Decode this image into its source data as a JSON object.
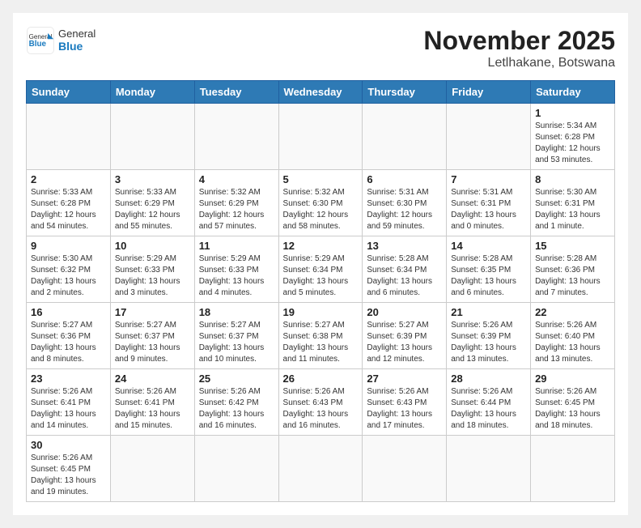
{
  "logo": {
    "general": "General",
    "blue": "Blue"
  },
  "header": {
    "title": "November 2025",
    "location": "Letlhakane, Botswana"
  },
  "weekdays": [
    "Sunday",
    "Monday",
    "Tuesday",
    "Wednesday",
    "Thursday",
    "Friday",
    "Saturday"
  ],
  "days": {
    "1": {
      "sunrise": "Sunrise: 5:34 AM",
      "sunset": "Sunset: 6:28 PM",
      "daylight": "Daylight: 12 hours and 53 minutes."
    },
    "2": {
      "sunrise": "Sunrise: 5:33 AM",
      "sunset": "Sunset: 6:28 PM",
      "daylight": "Daylight: 12 hours and 54 minutes."
    },
    "3": {
      "sunrise": "Sunrise: 5:33 AM",
      "sunset": "Sunset: 6:29 PM",
      "daylight": "Daylight: 12 hours and 55 minutes."
    },
    "4": {
      "sunrise": "Sunrise: 5:32 AM",
      "sunset": "Sunset: 6:29 PM",
      "daylight": "Daylight: 12 hours and 57 minutes."
    },
    "5": {
      "sunrise": "Sunrise: 5:32 AM",
      "sunset": "Sunset: 6:30 PM",
      "daylight": "Daylight: 12 hours and 58 minutes."
    },
    "6": {
      "sunrise": "Sunrise: 5:31 AM",
      "sunset": "Sunset: 6:30 PM",
      "daylight": "Daylight: 12 hours and 59 minutes."
    },
    "7": {
      "sunrise": "Sunrise: 5:31 AM",
      "sunset": "Sunset: 6:31 PM",
      "daylight": "Daylight: 13 hours and 0 minutes."
    },
    "8": {
      "sunrise": "Sunrise: 5:30 AM",
      "sunset": "Sunset: 6:31 PM",
      "daylight": "Daylight: 13 hours and 1 minute."
    },
    "9": {
      "sunrise": "Sunrise: 5:30 AM",
      "sunset": "Sunset: 6:32 PM",
      "daylight": "Daylight: 13 hours and 2 minutes."
    },
    "10": {
      "sunrise": "Sunrise: 5:29 AM",
      "sunset": "Sunset: 6:33 PM",
      "daylight": "Daylight: 13 hours and 3 minutes."
    },
    "11": {
      "sunrise": "Sunrise: 5:29 AM",
      "sunset": "Sunset: 6:33 PM",
      "daylight": "Daylight: 13 hours and 4 minutes."
    },
    "12": {
      "sunrise": "Sunrise: 5:29 AM",
      "sunset": "Sunset: 6:34 PM",
      "daylight": "Daylight: 13 hours and 5 minutes."
    },
    "13": {
      "sunrise": "Sunrise: 5:28 AM",
      "sunset": "Sunset: 6:34 PM",
      "daylight": "Daylight: 13 hours and 6 minutes."
    },
    "14": {
      "sunrise": "Sunrise: 5:28 AM",
      "sunset": "Sunset: 6:35 PM",
      "daylight": "Daylight: 13 hours and 6 minutes."
    },
    "15": {
      "sunrise": "Sunrise: 5:28 AM",
      "sunset": "Sunset: 6:36 PM",
      "daylight": "Daylight: 13 hours and 7 minutes."
    },
    "16": {
      "sunrise": "Sunrise: 5:27 AM",
      "sunset": "Sunset: 6:36 PM",
      "daylight": "Daylight: 13 hours and 8 minutes."
    },
    "17": {
      "sunrise": "Sunrise: 5:27 AM",
      "sunset": "Sunset: 6:37 PM",
      "daylight": "Daylight: 13 hours and 9 minutes."
    },
    "18": {
      "sunrise": "Sunrise: 5:27 AM",
      "sunset": "Sunset: 6:37 PM",
      "daylight": "Daylight: 13 hours and 10 minutes."
    },
    "19": {
      "sunrise": "Sunrise: 5:27 AM",
      "sunset": "Sunset: 6:38 PM",
      "daylight": "Daylight: 13 hours and 11 minutes."
    },
    "20": {
      "sunrise": "Sunrise: 5:27 AM",
      "sunset": "Sunset: 6:39 PM",
      "daylight": "Daylight: 13 hours and 12 minutes."
    },
    "21": {
      "sunrise": "Sunrise: 5:26 AM",
      "sunset": "Sunset: 6:39 PM",
      "daylight": "Daylight: 13 hours and 13 minutes."
    },
    "22": {
      "sunrise": "Sunrise: 5:26 AM",
      "sunset": "Sunset: 6:40 PM",
      "daylight": "Daylight: 13 hours and 13 minutes."
    },
    "23": {
      "sunrise": "Sunrise: 5:26 AM",
      "sunset": "Sunset: 6:41 PM",
      "daylight": "Daylight: 13 hours and 14 minutes."
    },
    "24": {
      "sunrise": "Sunrise: 5:26 AM",
      "sunset": "Sunset: 6:41 PM",
      "daylight": "Daylight: 13 hours and 15 minutes."
    },
    "25": {
      "sunrise": "Sunrise: 5:26 AM",
      "sunset": "Sunset: 6:42 PM",
      "daylight": "Daylight: 13 hours and 16 minutes."
    },
    "26": {
      "sunrise": "Sunrise: 5:26 AM",
      "sunset": "Sunset: 6:43 PM",
      "daylight": "Daylight: 13 hours and 16 minutes."
    },
    "27": {
      "sunrise": "Sunrise: 5:26 AM",
      "sunset": "Sunset: 6:43 PM",
      "daylight": "Daylight: 13 hours and 17 minutes."
    },
    "28": {
      "sunrise": "Sunrise: 5:26 AM",
      "sunset": "Sunset: 6:44 PM",
      "daylight": "Daylight: 13 hours and 18 minutes."
    },
    "29": {
      "sunrise": "Sunrise: 5:26 AM",
      "sunset": "Sunset: 6:45 PM",
      "daylight": "Daylight: 13 hours and 18 minutes."
    },
    "30": {
      "sunrise": "Sunrise: 5:26 AM",
      "sunset": "Sunset: 6:45 PM",
      "daylight": "Daylight: 13 hours and 19 minutes."
    }
  }
}
